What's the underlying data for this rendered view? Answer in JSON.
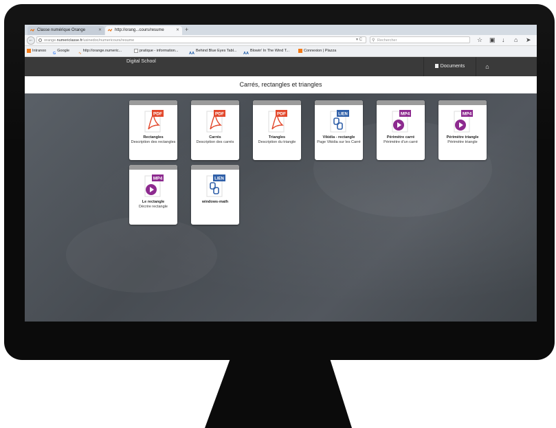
{
  "browser": {
    "tabs": [
      {
        "label": "Classe numérique Orange",
        "active": false
      },
      {
        "label": "http://orang...cours/resume",
        "active": true
      }
    ],
    "url": {
      "prefix": "orange.",
      "host": "numericlasse.fr",
      "path": "/usinedoc/numericours/resume"
    },
    "search_placeholder": "Rechercher",
    "bookmarks": [
      {
        "label": "Intranoo"
      },
      {
        "label": "Google"
      },
      {
        "label": "http://orange.numeric..."
      },
      {
        "label": "pratique - information..."
      },
      {
        "label": "Behind Blue Eyes Tabl..."
      },
      {
        "label": "Blowin' In The Wind T..."
      },
      {
        "label": "Connexion | Plazza"
      }
    ]
  },
  "site": {
    "brand": "Digital School",
    "nav": {
      "documents_label": "Documents"
    },
    "page_title": "Carrés, rectangles et triangles"
  },
  "resources": [
    {
      "type": "PDF",
      "title": "Rectangles",
      "description": "Description des rectangles"
    },
    {
      "type": "PDF",
      "title": "Carrés",
      "description": "Description des carrés"
    },
    {
      "type": "PDF",
      "title": "Triangles",
      "description": "Description du triangle"
    },
    {
      "type": "LIEN",
      "title": "Vikidia - rectangle",
      "description": "Page Vikidia sur les Carré"
    },
    {
      "type": "MP4",
      "title": "Périmètre carré",
      "description": "Périmètre d'un carré"
    },
    {
      "type": "MP4",
      "title": "Périmètre triangle",
      "description": "Périmètre triangle"
    },
    {
      "type": "MP4",
      "title": "Le rectangle",
      "description": "Décrire rectangle"
    },
    {
      "type": "LIEN",
      "title": "windows-math",
      "description": ""
    }
  ],
  "colors": {
    "pdf": "#e2472b",
    "mp4": "#8d2a8f",
    "lien": "#2f5fa8",
    "header": "#3a3a3a"
  }
}
